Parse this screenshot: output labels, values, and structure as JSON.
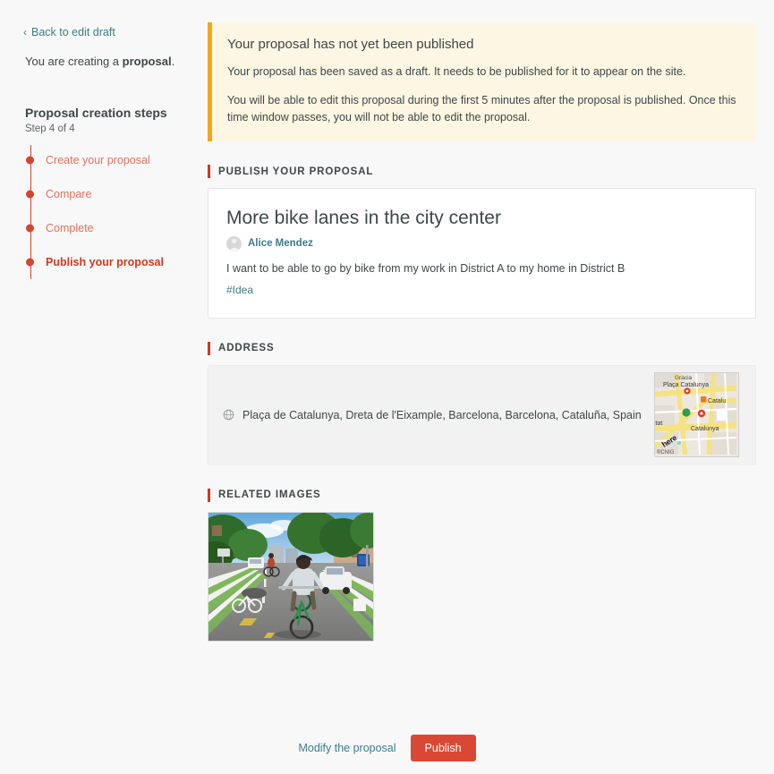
{
  "sidebar": {
    "back_link": "Back to edit draft",
    "back_chevron": "‹",
    "creating_prefix": "You are creating a ",
    "creating_strong": "proposal",
    "creating_suffix": ".",
    "steps_title": "Proposal creation steps",
    "steps_progress": "Step 4 of 4",
    "steps": [
      {
        "label": "Create your proposal",
        "current": false
      },
      {
        "label": "Compare",
        "current": false
      },
      {
        "label": "Complete",
        "current": false
      },
      {
        "label": "Publish your proposal",
        "current": true
      }
    ]
  },
  "callout": {
    "title": "Your proposal has not yet been published",
    "paragraph_1": "Your proposal has been saved as a draft. It needs to be published for it to appear on the site.",
    "paragraph_2": "You will be able to edit this proposal during the first 5 minutes after the proposal is published. Once this time window passes, you will not be able to edit the proposal.",
    "accent_color": "#f0a81c",
    "background_color": "#fdf6e3"
  },
  "sections": {
    "publish": "PUBLISH YOUR PROPOSAL",
    "address": "ADDRESS",
    "related_images": "RELATED IMAGES",
    "bar_color": "#cf3a23"
  },
  "proposal": {
    "title": "More bike lanes in the city center",
    "author": "Alice Mendez",
    "body": "I want to be able to go by bike from my work in District A to my home in District B",
    "tag": "#Idea"
  },
  "address": {
    "value": "Plaça de Catalunya, Dreta de l'Eixample, Barcelona, Barcelona, Cataluña, Spain",
    "map": {
      "label_gracia": "Gràcia",
      "label_placa": "Plaça Catalunya",
      "label_catalu": "Catalu",
      "label_catalunya": "Catalunya",
      "label_itat": "itat",
      "attribution": "®CNIG",
      "provider": "here"
    }
  },
  "related_images": [
    {
      "alt": "Cyclist riding in a green-painted bike lane on a tree-lined city avenue"
    }
  ],
  "footer": {
    "modify_label": "Modify the proposal",
    "publish_label": "Publish",
    "publish_color": "#d94834"
  }
}
